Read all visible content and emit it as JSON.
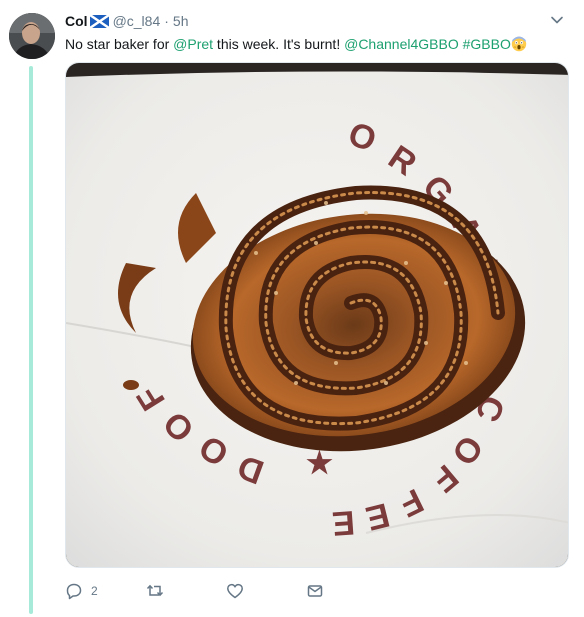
{
  "tweet": {
    "display_name": "Col",
    "handle": "@c_l84",
    "separator": "·",
    "time": "5h",
    "text": {
      "part1": "No star baker for ",
      "mention1": "@Pret",
      "part2": " this week.  It's burnt! ",
      "mention2": "@Channel4GBBO",
      "space": " ",
      "hashtag": "#GBBO"
    },
    "media": {
      "alt": "photo of a cinnamon swirl pastry on branded paper",
      "paper_text": "ORGANIC COFFEE ★ FOOD"
    },
    "actions": {
      "reply_count": "2",
      "retweet_count": "",
      "like_count": ""
    }
  },
  "colors": {
    "link": "#1da070",
    "thread_line": "#a8ead9",
    "icon_gray": "#657786",
    "flag_blue": "#1d5fbf"
  },
  "icons": {
    "flag": "scotland-flag-icon",
    "emoji": "face-screaming-emoji-icon",
    "caret": "chevron-down-icon",
    "reply": "reply-icon",
    "retweet": "retweet-icon",
    "like": "heart-icon",
    "dm": "envelope-icon"
  }
}
